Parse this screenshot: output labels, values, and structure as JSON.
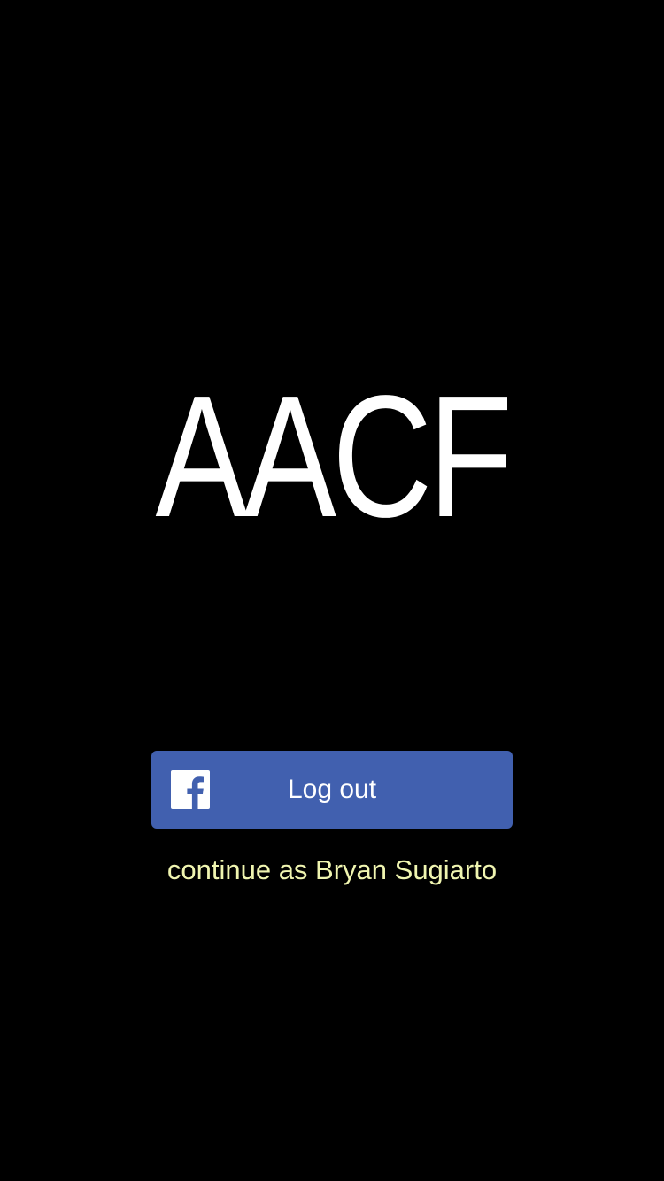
{
  "app": {
    "logo_text": "AACF"
  },
  "login": {
    "button_label": "Log out",
    "button_icon": "facebook-icon",
    "continue_text": "continue as Bryan Sugiarto"
  },
  "colors": {
    "background": "#000000",
    "facebook_blue": "#4160af",
    "continue_text": "#f0f5b0"
  }
}
